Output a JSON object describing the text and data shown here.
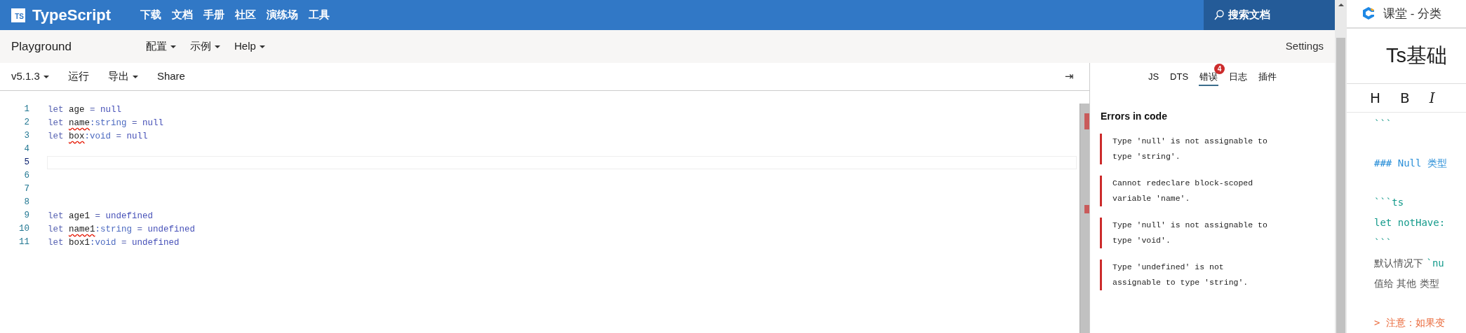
{
  "header": {
    "logo_badge": "TS",
    "brand": "TypeScript",
    "nav": [
      "下载",
      "文档",
      "手册",
      "社区",
      "演练场",
      "工具"
    ],
    "search": "搜索文档"
  },
  "subnav": {
    "title": "Playground",
    "menus": [
      "配置",
      "示例",
      "Help"
    ],
    "settings": "Settings"
  },
  "toolbar": {
    "items": [
      {
        "label": "v5.1.3",
        "dropdown": true
      },
      {
        "label": "运行",
        "dropdown": false
      },
      {
        "label": "导出",
        "dropdown": true
      },
      {
        "label": "Share",
        "dropdown": false
      }
    ],
    "collapse_icon": "⇥"
  },
  "editor": {
    "lines": [
      {
        "number": "1",
        "current": false,
        "tokens": [
          {
            "text": "let ",
            "kind": "keyword",
            "error": false
          },
          {
            "text": "age",
            "kind": "identifier",
            "error": false
          },
          {
            "text": " = ",
            "kind": "operator",
            "error": false
          },
          {
            "text": "null",
            "kind": "literal",
            "error": false
          }
        ]
      },
      {
        "number": "2",
        "current": false,
        "tokens": [
          {
            "text": "let ",
            "kind": "keyword",
            "error": false
          },
          {
            "text": "name",
            "kind": "identifier",
            "error": true
          },
          {
            "text": ":string",
            "kind": "type",
            "error": false
          },
          {
            "text": " = ",
            "kind": "operator",
            "error": false
          },
          {
            "text": "null",
            "kind": "literal",
            "error": false
          }
        ]
      },
      {
        "number": "3",
        "current": false,
        "tokens": [
          {
            "text": "let ",
            "kind": "keyword",
            "error": false
          },
          {
            "text": "box",
            "kind": "identifier",
            "error": true
          },
          {
            "text": ":void",
            "kind": "type",
            "error": false
          },
          {
            "text": " = ",
            "kind": "operator",
            "error": false
          },
          {
            "text": "null",
            "kind": "literal",
            "error": false
          }
        ]
      },
      {
        "number": "4",
        "current": false
      },
      {
        "number": "5",
        "current": true
      },
      {
        "number": "6",
        "current": false
      },
      {
        "number": "7",
        "current": false
      },
      {
        "number": "8",
        "current": false
      },
      {
        "number": "9",
        "current": false,
        "tokens": [
          {
            "text": "let ",
            "kind": "keyword",
            "error": false
          },
          {
            "text": "age1",
            "kind": "identifier",
            "error": false
          },
          {
            "text": " = ",
            "kind": "operator",
            "error": false
          },
          {
            "text": "undefined",
            "kind": "literal",
            "error": false
          }
        ]
      },
      {
        "number": "10",
        "current": false,
        "tokens": [
          {
            "text": "let ",
            "kind": "keyword",
            "error": false
          },
          {
            "text": "name1",
            "kind": "identifier",
            "error": true
          },
          {
            "text": ":string",
            "kind": "type",
            "error": false
          },
          {
            "text": " = ",
            "kind": "operator",
            "error": false
          },
          {
            "text": "undefined",
            "kind": "literal",
            "error": false
          }
        ]
      },
      {
        "number": "11",
        "current": false,
        "tokens": [
          {
            "text": "let ",
            "kind": "keyword",
            "error": false
          },
          {
            "text": "box1",
            "kind": "identifier",
            "error": false
          },
          {
            "text": ":void",
            "kind": "type",
            "error": false
          },
          {
            "text": " = ",
            "kind": "operator",
            "error": false
          },
          {
            "text": "undefined",
            "kind": "literal",
            "error": false
          }
        ]
      }
    ]
  },
  "sidebar": {
    "tabs": [
      {
        "label": "JS",
        "selected": false
      },
      {
        "label": "DTS",
        "selected": false
      },
      {
        "label": "错误",
        "selected": true,
        "badge": "4"
      },
      {
        "label": "日志",
        "selected": false
      },
      {
        "label": "插件",
        "selected": false
      }
    ],
    "heading": "Errors in code",
    "errors": [
      "Type 'null' is not assignable to type 'string'.",
      "Cannot redeclare block-scoped variable 'name'.",
      "Type 'null' is not assignable to type 'void'.",
      "Type 'undefined' is not assignable to type 'string'."
    ]
  },
  "side_app": {
    "title": "课堂 - 分类",
    "doc_title": "Ts基础",
    "format_buttons": [
      {
        "label": "H",
        "kind": "heading"
      },
      {
        "label": "B",
        "kind": "bold"
      },
      {
        "label": "I",
        "kind": "italic"
      }
    ],
    "paragraphs": [
      {
        "lines": [
          {
            "segments": [
              {
                "text": "```",
                "kind": "fence"
              }
            ]
          }
        ]
      },
      {
        "lines": [
          {
            "segments": [
              {
                "text": "### Null 类型",
                "kind": "heading"
              }
            ]
          }
        ]
      },
      {
        "lines": [
          {
            "segments": [
              {
                "text": "```ts",
                "kind": "code"
              }
            ]
          },
          {
            "segments": [
              {
                "text": "let notHave:",
                "kind": "code"
              }
            ]
          },
          {
            "segments": [
              {
                "text": "```",
                "kind": "fence"
              }
            ]
          },
          {
            "segments": [
              {
                "text": "默认情况下 ",
                "kind": "text"
              },
              {
                "text": "`nu",
                "kind": "code"
              }
            ]
          },
          {
            "segments": [
              {
                "text": "值给 其他 类型",
                "kind": "text"
              }
            ]
          }
        ]
      },
      {
        "lines": [
          {
            "segments": [
              {
                "text": "> 注意：如果变",
                "kind": "quote"
              }
            ]
          }
        ]
      }
    ]
  }
}
